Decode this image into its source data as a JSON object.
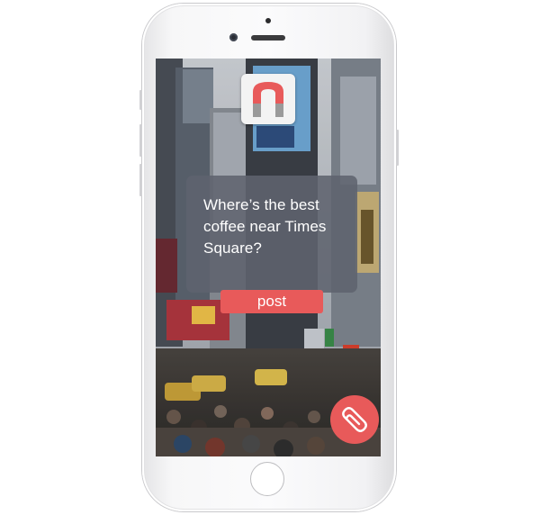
{
  "app": {
    "logo_letter": "n",
    "brand_color": "#e85a5a"
  },
  "question": {
    "text": "Where’s the best coffee near Times Square?"
  },
  "actions": {
    "post_label": "post",
    "attach_icon": "paperclip-icon"
  },
  "device": {
    "frame_color": "#f5f5f6"
  }
}
